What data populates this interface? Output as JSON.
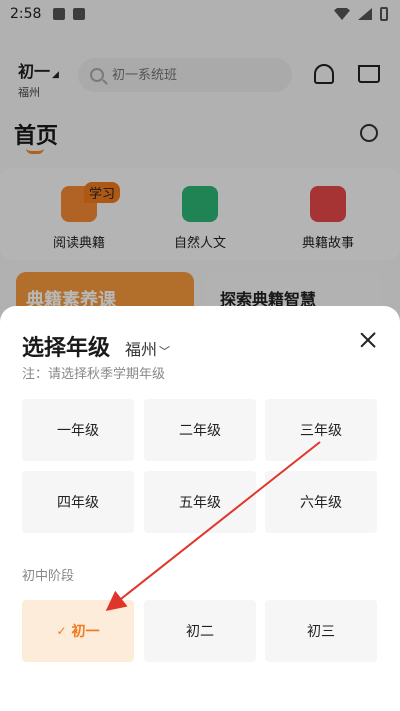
{
  "status_bar": {
    "time": "2:58"
  },
  "header": {
    "grade": "初一",
    "city": "福州",
    "search_placeholder": "初一系统班"
  },
  "home": {
    "title": "首页",
    "categories": [
      {
        "label": "阅读典籍",
        "badge": "学习",
        "color": "#f48a34"
      },
      {
        "label": "自然人文",
        "color": "#2bb673"
      },
      {
        "label": "典籍故事",
        "color": "#e84848"
      }
    ],
    "banners": [
      "典籍素养课",
      "探索典籍智慧"
    ]
  },
  "sheet": {
    "title": "选择年级",
    "city": "福州",
    "note": "注：请选择秋季学期年级",
    "primary_grades": [
      "一年级",
      "二年级",
      "三年级",
      "四年级",
      "五年级",
      "六年级"
    ],
    "middle_label": "初中阶段",
    "middle_grades": [
      "初一",
      "初二",
      "初三"
    ],
    "selected": "初一"
  },
  "colors": {
    "accent": "#f07a1e",
    "selected_bg": "#fdecd9",
    "annotation_arrow": "#e0352b"
  }
}
